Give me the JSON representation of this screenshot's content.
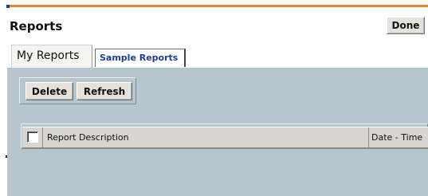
{
  "header": {
    "title": "Reports",
    "done_label": "Done"
  },
  "tabs": [
    {
      "label": "My Reports",
      "selected": true
    },
    {
      "label": "Sample Reports",
      "selected": false
    }
  ],
  "toolbar": {
    "delete_label": "Delete",
    "refresh_label": "Refresh"
  },
  "table": {
    "select_all_checked": false,
    "columns": [
      "Report Description",
      "Date - Time"
    ]
  },
  "colors": {
    "accent_orange": "#d98a2b",
    "panel_background": "#b7c5cc",
    "tab_link_blue": "#1d3d93"
  }
}
